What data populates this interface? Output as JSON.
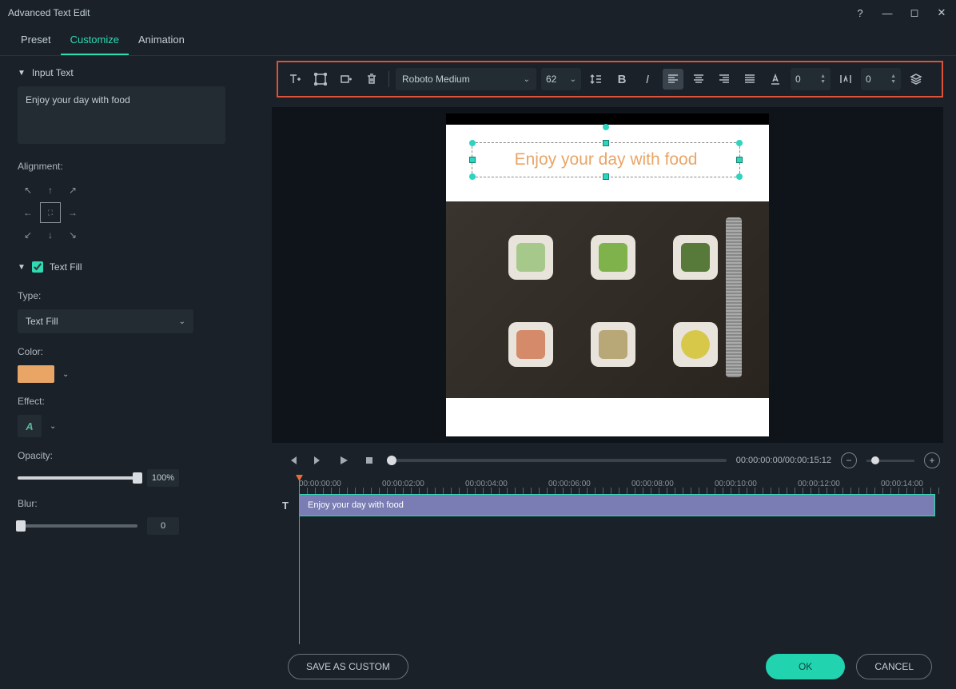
{
  "window": {
    "title": "Advanced Text Edit"
  },
  "tabs": {
    "preset": "Preset",
    "customize": "Customize",
    "animation": "Animation"
  },
  "sidebar": {
    "input_text_head": "Input Text",
    "input_text_value": "Enjoy your day with food",
    "alignment_label": "Alignment:",
    "text_fill_head": "Text Fill",
    "type_label": "Type:",
    "type_value": "Text Fill",
    "color_label": "Color:",
    "color_hex": "#e9a566",
    "effect_label": "Effect:",
    "effect_value": "A",
    "opacity_label": "Opacity:",
    "opacity_value": "100%",
    "blur_label": "Blur:",
    "blur_value": "0"
  },
  "toolbar": {
    "font": "Roboto Medium",
    "size": "62",
    "letter_spacing": "0",
    "line_spacing": "0"
  },
  "preview": {
    "text": "Enjoy your day with food"
  },
  "player": {
    "timecode": "00:00:00:00/00:00:15:12"
  },
  "timeline": {
    "marks": [
      "00:00:00:00",
      "00:00:02:00",
      "00:00:04:00",
      "00:00:06:00",
      "00:00:08:00",
      "00:00:10:00",
      "00:00:12:00",
      "00:00:14:00"
    ],
    "clip_label": "Enjoy your day with food",
    "track_icon": "T"
  },
  "footer": {
    "save": "SAVE AS CUSTOM",
    "ok": "OK",
    "cancel": "CANCEL"
  }
}
